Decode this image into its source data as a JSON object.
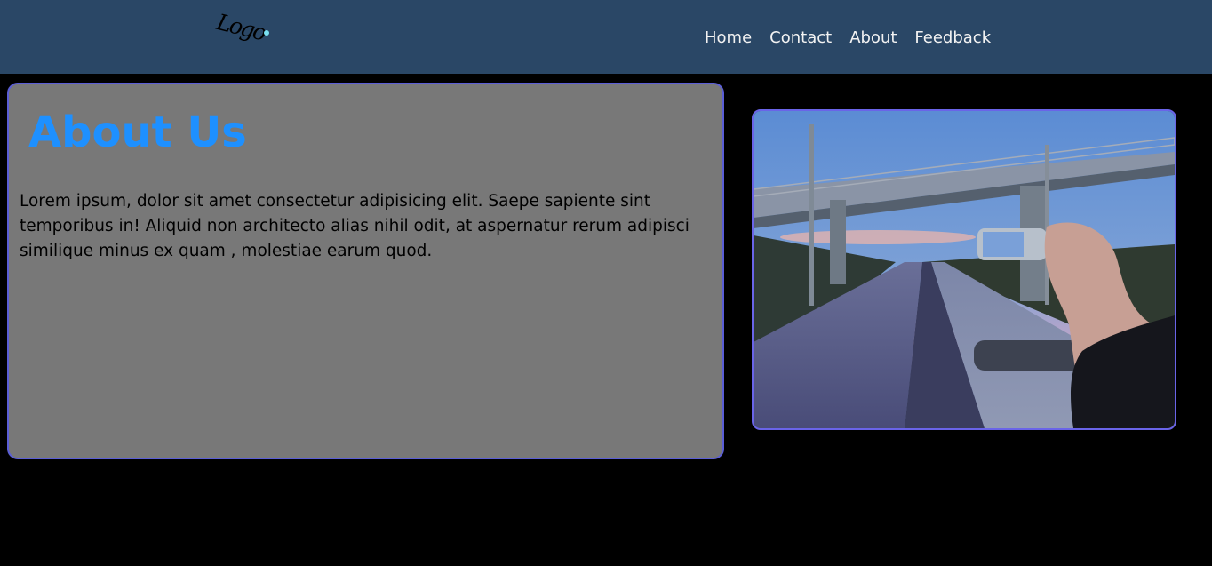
{
  "header": {
    "logo_text": "Logo",
    "nav": [
      {
        "label": "Home"
      },
      {
        "label": "Contact"
      },
      {
        "label": "About"
      },
      {
        "label": "Feedback"
      }
    ]
  },
  "about": {
    "title": "About Us",
    "body": "Lorem ipsum, dolor sit amet consectetur adipisicing elit. Saepe sapiente sint temporibus in! Aliquid non architecto alias nihil odit, at aspernatur rerum adipisci similique minus ex quam , molestiae earum quod."
  },
  "colors": {
    "navbar": "#2a4766",
    "card": "#787878",
    "card_border": "#5b5ed6",
    "title": "#1e90ff",
    "page_bg": "#000000"
  }
}
